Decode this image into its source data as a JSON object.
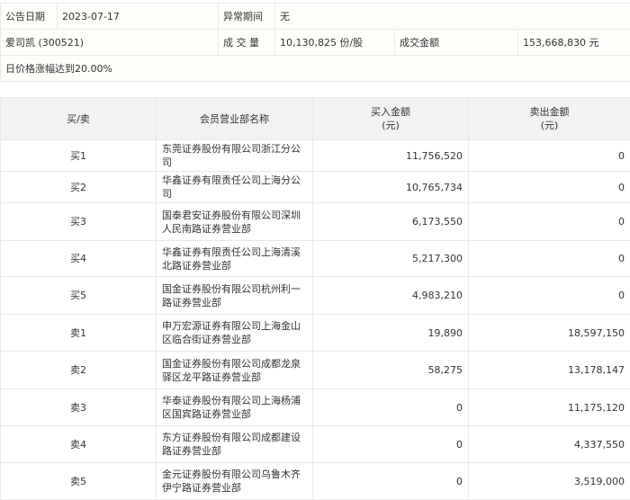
{
  "info": {
    "date_label": "公告日期",
    "date": "2023-07-17",
    "period_label": "异常期间",
    "period": "无",
    "stock": "爱司凯 (300521)",
    "volume_label": "成 交 量",
    "volume": "10,130,825 份/股",
    "amount_label": "成交金额",
    "amount": "153,668,830 元",
    "reason": "日价格涨幅达到20.00%"
  },
  "table": {
    "headers": [
      "买/卖",
      "会员营业部名称",
      "买入金额",
      "卖出金额"
    ],
    "unit": "(元)",
    "rows": [
      {
        "side": "买1",
        "name": "东莞证券股份有限公司浙江分公司",
        "buy": "11,756,520",
        "sell": "0"
      },
      {
        "side": "买2",
        "name": "华鑫证券有限责任公司上海分公司",
        "buy": "10,765,734",
        "sell": "0"
      },
      {
        "side": "买3",
        "name": "国泰君安证券股份有限公司深圳人民南路证券营业部",
        "buy": "6,173,550",
        "sell": "0"
      },
      {
        "side": "买4",
        "name": "华鑫证券有限责任公司上海清溪北路证券营业部",
        "buy": "5,217,300",
        "sell": "0"
      },
      {
        "side": "买5",
        "name": "国金证券股份有限公司杭州利一路证券营业部",
        "buy": "4,983,210",
        "sell": "0"
      },
      {
        "side": "卖1",
        "name": "申万宏源证券有限公司上海金山区临合街证券营业部",
        "buy": "19,890",
        "sell": "18,597,150"
      },
      {
        "side": "卖2",
        "name": "国金证券股份有限公司成都龙泉驿区龙平路证券营业部",
        "buy": "58,275",
        "sell": "13,178,147"
      },
      {
        "side": "卖3",
        "name": "华泰证券股份有限公司上海杨浦区国宾路证券营业部",
        "buy": "0",
        "sell": "11,175,120"
      },
      {
        "side": "卖4",
        "name": "东方证券股份有限公司成都建设路证券营业部",
        "buy": "0",
        "sell": "4,337,550"
      },
      {
        "side": "卖5",
        "name": "金元证券股份有限公司乌鲁木齐伊宁路证券营业部",
        "buy": "0",
        "sell": "3,519,000"
      }
    ]
  }
}
